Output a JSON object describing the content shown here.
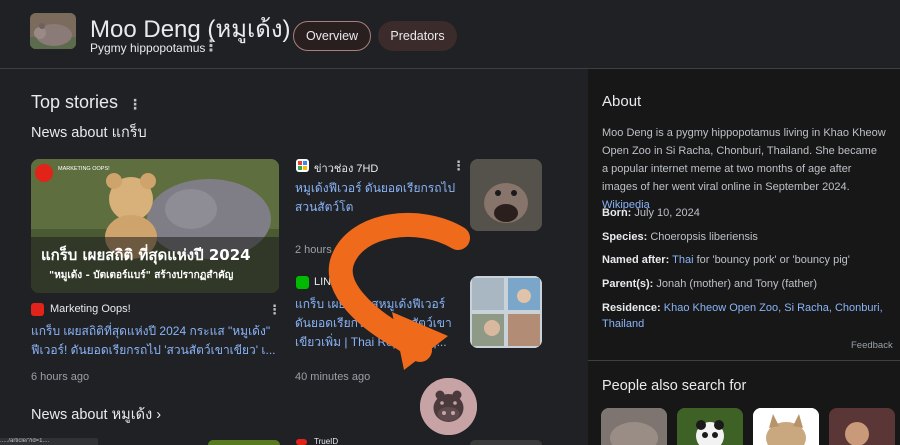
{
  "header": {
    "title": "Moo Deng (หมูเด้ง)",
    "subtitle": "Pygmy hippopotamus",
    "tabs": [
      "Overview",
      "Predators"
    ]
  },
  "top_stories": {
    "heading": "Top stories",
    "news_about_heading": "News about แกร็บ",
    "featured": {
      "image_caption_line1": "แกร็บ เผยสถิติ ที่สุดแห่งปี 2024",
      "image_caption_line2": "\"หมูเด้ง - บัตเตอร์แบร์\" สร้างปรากฏสำคัญ",
      "image_brand": "MARKETING OOPS!",
      "source": "Marketing Oops!",
      "title": "แกร็บ เผยสถิติที่สุดแห่งปี 2024 กระแส \"หมูเด้ง\" ฟีเวอร์! ดันยอดเรียกรถไป 'สวนสัตว์เขาเขียว' เ...",
      "age": "6 hours ago"
    },
    "story2": {
      "source": "ข่าวช่อง 7HD",
      "title": "หมูเด้งฟีเวอร์ ดันยอดเรียกรถไป สวนสัตว์โต",
      "age": "2 hours ago"
    },
    "story3": {
      "source": "LINE",
      "title": "แกร็บ เผยสถิติ สหมูเด้งฟีเวอร์ ดันยอดเรียกรถไป สวนสัตว์เขา เขียวเพิ่ม | Thai Reporters |...",
      "age": "40 minutes ago"
    },
    "news_about_2": "News about หมูเด้ง",
    "next_source": "TrueID",
    "status_url": "...../article/?id=1...."
  },
  "about": {
    "heading": "About",
    "description": "Moo Deng is a pygmy hippopotamus living in Khao Kheow Open Zoo in Si Racha, Chonburi, Thailand. She became a popular internet meme at two months of age after images of her went viral online in September 2024.",
    "wiki_link": "Wikipedia",
    "facts": [
      {
        "label": "Born:",
        "value": "July 10, 2024"
      },
      {
        "label": "Species:",
        "value": "Choeropsis liberiensis"
      },
      {
        "label": "Named after:",
        "value_link": "Thai",
        "value": " for 'bouncy pork' or 'bouncy pig'"
      },
      {
        "label": "Parent(s):",
        "value": "Jonah (mother) and Tony (father)"
      },
      {
        "label": "Residence:",
        "value_link": "Khao Kheow Open Zoo, Si Racha, Chonburi, Thailand",
        "value": ""
      }
    ],
    "feedback": "Feedback"
  },
  "people_also_search": {
    "heading": "People also search for"
  },
  "colors": {
    "background": "#202124",
    "link": "#8ab4f8",
    "annotation_arrow": "#f06a1c"
  }
}
